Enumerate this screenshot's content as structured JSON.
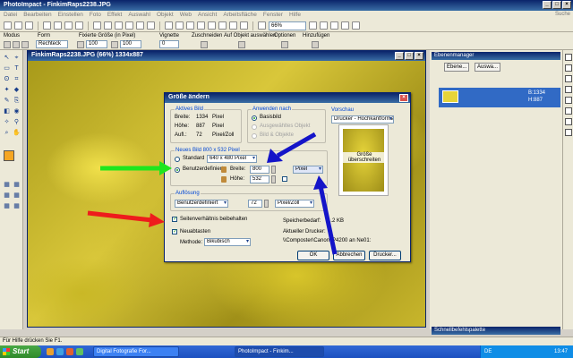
{
  "app": {
    "title": "PhotoImpact - FinkimRaps2238.JPG"
  },
  "menu": [
    "Datei",
    "Bearbeiten",
    "Einstellen",
    "Foto",
    "Effekt",
    "Auswahl",
    "Objekt",
    "Web",
    "Ansicht",
    "Arbeitsfläche",
    "Fenster",
    "Hilfe"
  ],
  "toolbar": {
    "zoom": "66%"
  },
  "options": {
    "modus_label": "Modus",
    "form_label": "Form",
    "form_value": "Rechteck",
    "fixsize_label": "Fixierte Größe (in Pixel)",
    "w": "100",
    "h": "100",
    "vignette_label": "Vignette",
    "vignette_value": "0",
    "zuschneiden": "Zuschneiden",
    "auf_objekt": "Auf Objekt auswählen",
    "optionen": "Optionen",
    "hinzufuegen": "Hinzufügen"
  },
  "document": {
    "title": "FinkimRaps2238.JPG (66%) 1334x887"
  },
  "dialog": {
    "title": "Größe ändern",
    "aktives_bild": "Aktives Bild",
    "breite_label": "Breite:",
    "breite_value": "1334",
    "breite_unit": "Pixel",
    "hoehe_label": "Höhe:",
    "hoehe_value": "887",
    "hoehe_unit": "Pixel",
    "aufl_label": "Aufl.:",
    "aufl_value": "72",
    "aufl_unit": "Pixel/Zoll",
    "anwenden_nach": "Anwenden nach",
    "basisbild": "Basisbild",
    "ausgewaehltes_objekt": "Ausgewähltes Objekt",
    "bild_objekte": "Bild & Objekte",
    "vorschau": "Vorschau",
    "vorschau_select": "Drucker - Hochkantformat",
    "groesse_ueberschreiten": "Größe überschreiten",
    "neues_bild": "Neues Bild 800 x 532 Pixel",
    "standard": "Standard",
    "standard_value": "640 x 480 Pixel",
    "benutzerdefiniert": "Benutzerdefiniert",
    "new_breite_label": "Breite:",
    "new_breite_value": "800",
    "new_hoehe_label": "Höhe:",
    "new_hoehe_value": "532",
    "unit_value": "Pixel",
    "aufloesung": "Auflösung",
    "aufl_mode": "Benutzerdefiniert",
    "aufl_num": "72",
    "aufl_unit2": "Pixel/Zoll",
    "seitenverhaeltnis": "Seitenverhältnis beibehalten",
    "neuabtasten": "Neuabtasten",
    "methode_label": "Methode:",
    "methode_value": "Bikubisch",
    "speicherbedarf_label": "Speicherbedarf:",
    "speicherbedarf_value": "1.2 KB",
    "aktueller_drucker": "Aktueller Drucker:",
    "drucker_path": "\\\\Composter\\Canon iP4200 an Ne01:",
    "ok": "OK",
    "abbrechen": "Abbrechen",
    "drucker_btn": "Drucker..."
  },
  "panels": {
    "ebenenmanager": "Ebenenmanager",
    "ebene_btn": "Ebene...",
    "auswahl_btn": "Auswa...",
    "layer_b": "B:1334",
    "layer_h": "H:887",
    "schnellbefehl": "Schnellbefehlspalette",
    "suche": "Suche"
  },
  "status": {
    "text": "Für Hilfe drücken Sie F1."
  },
  "taskbar": {
    "start": "Start",
    "task1": "Digital Fotografie For...",
    "task2": "PhotoImpact - Finkim...",
    "lang": "DE",
    "time": "13:47"
  },
  "colors": {
    "green_arrow": "#1ee61e",
    "red_arrow": "#ee1c1c",
    "blue_arrow": "#1414c8"
  }
}
